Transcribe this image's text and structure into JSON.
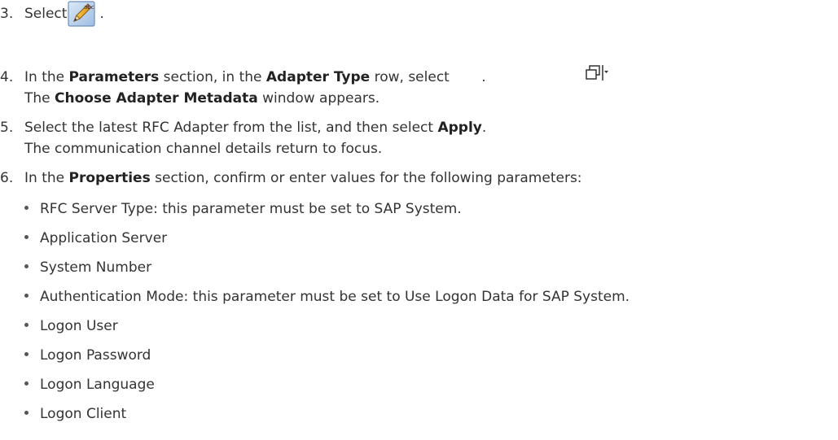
{
  "steps": [
    {
      "num": "3.",
      "before": "Select",
      "after": "."
    },
    {
      "num": "4.",
      "p1": "In the ",
      "b1": "Parameters",
      "p2": " section, in the ",
      "b2": "Adapter Type",
      "p3": " row, select ",
      "after": ".",
      "result_b": "Choose Adapter Metadata",
      "result_p": " window appears.",
      "result_prefix": "The "
    },
    {
      "num": "5.",
      "p1": "Select the latest RFC Adapter from the list, and then select ",
      "b1": "Apply",
      "after": ".",
      "result": "The communication channel details return to focus."
    },
    {
      "num": "6.",
      "p1": "In the ",
      "b1": "Properties",
      "p2": " section, confirm or enter values for the following parameters:"
    }
  ],
  "parameters": [
    "RFC Server Type: this parameter must be set to SAP System.",
    "Application Server",
    "System Number",
    "Authentication Mode: this parameter must be set to Use Logon Data for SAP System.",
    "Logon User",
    "Logon Password",
    "Logon Language",
    "Logon Client"
  ],
  "icons": {
    "edit": "edit-pencil-icon",
    "adapter": "choose-adapter-dropdown-icon"
  }
}
